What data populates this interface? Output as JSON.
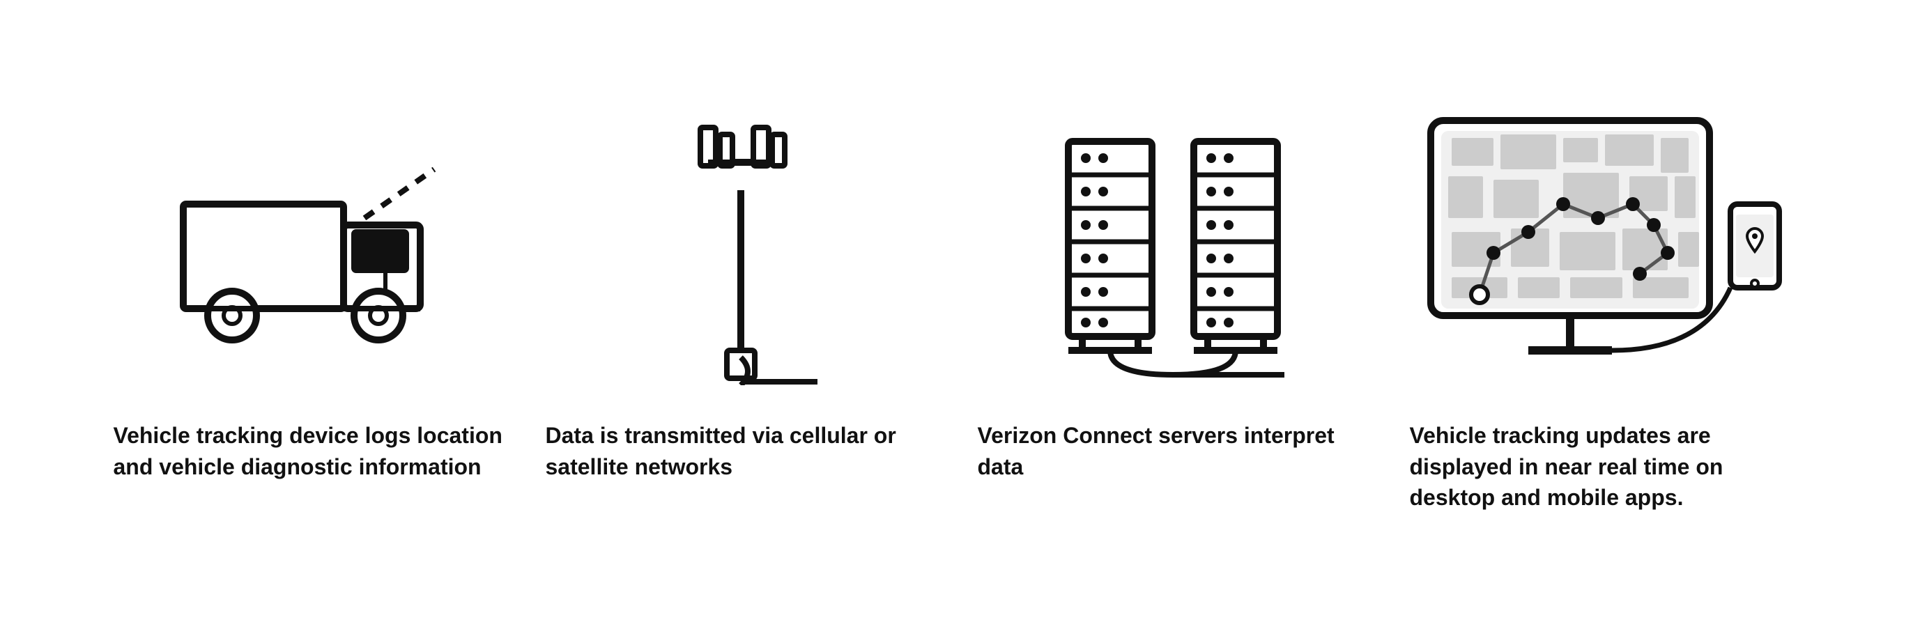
{
  "steps": [
    {
      "id": "step-truck",
      "caption": "Vehicle tracking device logs location and vehicle diagnostic information"
    },
    {
      "id": "step-tower",
      "caption": "Data is transmitted via cellular or satellite networks"
    },
    {
      "id": "step-servers",
      "caption": "Verizon Connect servers interpret data"
    },
    {
      "id": "step-monitor",
      "caption": "Vehicle tracking updates are displayed in near real time on desktop and mobile apps."
    }
  ]
}
